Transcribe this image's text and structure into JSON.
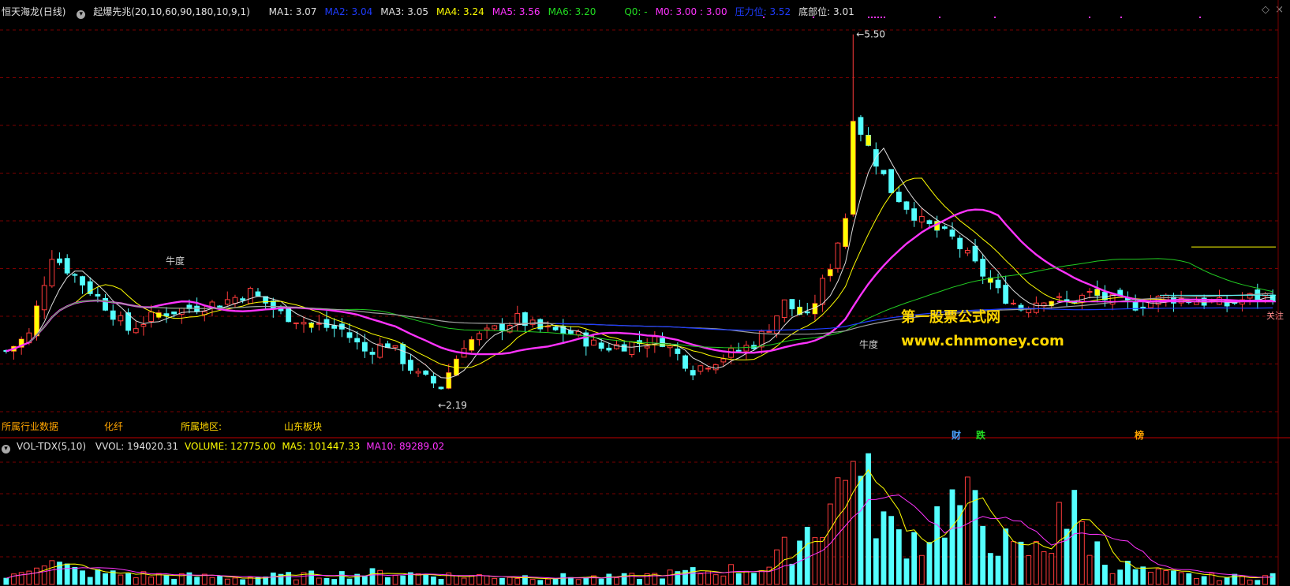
{
  "header": {
    "stock_name": "恒天海龙",
    "period": "(日线)",
    "indicator_name": "起爆先兆",
    "indicator_params": "(20,10,60,90,180,10,9,1)",
    "items": [
      {
        "label": "MA1: 3.07",
        "color": "#e0e0e0"
      },
      {
        "label": "MA2: 3.04",
        "color": "#1e3cff"
      },
      {
        "label": "MA3: 3.05",
        "color": "#e0e0e0"
      },
      {
        "label": "MA4: 3.24",
        "color": "#ffff00"
      },
      {
        "label": "MA5: 3.56",
        "color": "#ff33ff"
      },
      {
        "label": "MA6: 3.20",
        "color": "#22dd22"
      },
      {
        "label": "Q0: -",
        "color": "#22dd22"
      },
      {
        "label": "M0: 3.00 : 3.00",
        "color": "#ff33ff"
      },
      {
        "label": "压力位: 3.52",
        "color": "#1e3cff"
      },
      {
        "label": "底部位: 3.01",
        "color": "#e0e0e0"
      }
    ]
  },
  "annotations": {
    "high_price": "5.50",
    "low_price": "2.19",
    "niudu_1": "牛度",
    "niudu_2": "牛度",
    "industry_label": "所属行业数据",
    "industry_value": "化纤",
    "region_label": "所属地区:",
    "region_value": "山东板块",
    "signal_cai": "财",
    "signal_die": "跌",
    "signal_bang": "榜",
    "right_tag": "关注"
  },
  "watermark": {
    "line1": "第一股票公式网",
    "line2": "www.chnmoney.com"
  },
  "volume_header": {
    "name": "VOL-TDX(5,10)",
    "items": [
      {
        "label": "VVOL: 194020.31",
        "color": "#e0e0e0"
      },
      {
        "label": "VOLUME: 12775.00",
        "color": "#ffff00"
      },
      {
        "label": "MA5: 101447.33",
        "color": "#ffff00"
      },
      {
        "label": "MA10: 89289.02",
        "color": "#ff33ff"
      }
    ]
  },
  "colors": {
    "up": "#ff3b3b",
    "down": "#54ffff",
    "grid": "#7a0000",
    "ma_white": "#e0e0e0",
    "ma_yellow": "#ffff00",
    "ma_magenta": "#ff33ff",
    "ma_green": "#22cc22",
    "ma_gray": "#a0a0a0",
    "ma_blue": "#1e3cff"
  },
  "chart_data": {
    "type": "candlestick",
    "title": "恒天海龙 (日线)",
    "ylim": [
      2.0,
      5.6
    ],
    "close_profile": [
      [
        0,
        2.55
      ],
      [
        3,
        2.7
      ],
      [
        6,
        3.45
      ],
      [
        9,
        3.25
      ],
      [
        12,
        3.05
      ],
      [
        16,
        2.75
      ],
      [
        20,
        2.9
      ],
      [
        24,
        2.95
      ],
      [
        28,
        3.0
      ],
      [
        32,
        3.1
      ],
      [
        36,
        2.9
      ],
      [
        40,
        2.8
      ],
      [
        44,
        2.75
      ],
      [
        47,
        2.55
      ],
      [
        50,
        2.62
      ],
      [
        54,
        2.32
      ],
      [
        57,
        2.22
      ],
      [
        60,
        2.62
      ],
      [
        64,
        2.75
      ],
      [
        67,
        2.85
      ],
      [
        70,
        2.75
      ],
      [
        74,
        2.72
      ],
      [
        78,
        2.58
      ],
      [
        82,
        2.62
      ],
      [
        86,
        2.65
      ],
      [
        90,
        2.38
      ],
      [
        94,
        2.5
      ],
      [
        98,
        2.62
      ],
      [
        100,
        2.78
      ],
      [
        102,
        3.0
      ],
      [
        105,
        2.85
      ],
      [
        108,
        3.35
      ],
      [
        110,
        3.8
      ],
      [
        111,
        4.75
      ],
      [
        113,
        4.45
      ],
      [
        116,
        4.05
      ],
      [
        120,
        3.75
      ],
      [
        124,
        3.6
      ],
      [
        127,
        3.35
      ],
      [
        130,
        3.1
      ],
      [
        133,
        2.95
      ],
      [
        136,
        3.05
      ],
      [
        139,
        3.0
      ],
      [
        142,
        3.08
      ],
      [
        145,
        3.02
      ],
      [
        148,
        2.98
      ],
      [
        152,
        3.05
      ],
      [
        156,
        3.02
      ],
      [
        160,
        2.98
      ],
      [
        163,
        3.05
      ],
      [
        166,
        3.07
      ]
    ],
    "volume_profile": [
      [
        0,
        8000
      ],
      [
        4,
        45000
      ],
      [
        10,
        20000
      ],
      [
        30,
        12000
      ],
      [
        50,
        20000
      ],
      [
        60,
        15000
      ],
      [
        80,
        12000
      ],
      [
        100,
        30000
      ],
      [
        106,
        110000
      ],
      [
        110,
        180000
      ],
      [
        113,
        160000
      ],
      [
        116,
        90000
      ],
      [
        120,
        80000
      ],
      [
        124,
        150000
      ],
      [
        128,
        110000
      ],
      [
        132,
        55000
      ],
      [
        136,
        60000
      ],
      [
        140,
        120000
      ],
      [
        144,
        40000
      ],
      [
        150,
        20000
      ],
      [
        155,
        15000
      ],
      [
        160,
        12000
      ],
      [
        166,
        15000
      ]
    ],
    "ma_last": {
      "MA1": 3.07,
      "MA2": 3.04,
      "MA3": 3.05,
      "MA4": 3.24,
      "MA5": 3.56,
      "MA6": 3.2
    },
    "pressure_level": 3.52,
    "bottom_level": 3.01,
    "high": 5.5,
    "low": 2.19,
    "last_volume": 12775.0,
    "vvol": 194020.31,
    "vol_ma5": 101447.33,
    "vol_ma10": 89289.02
  }
}
